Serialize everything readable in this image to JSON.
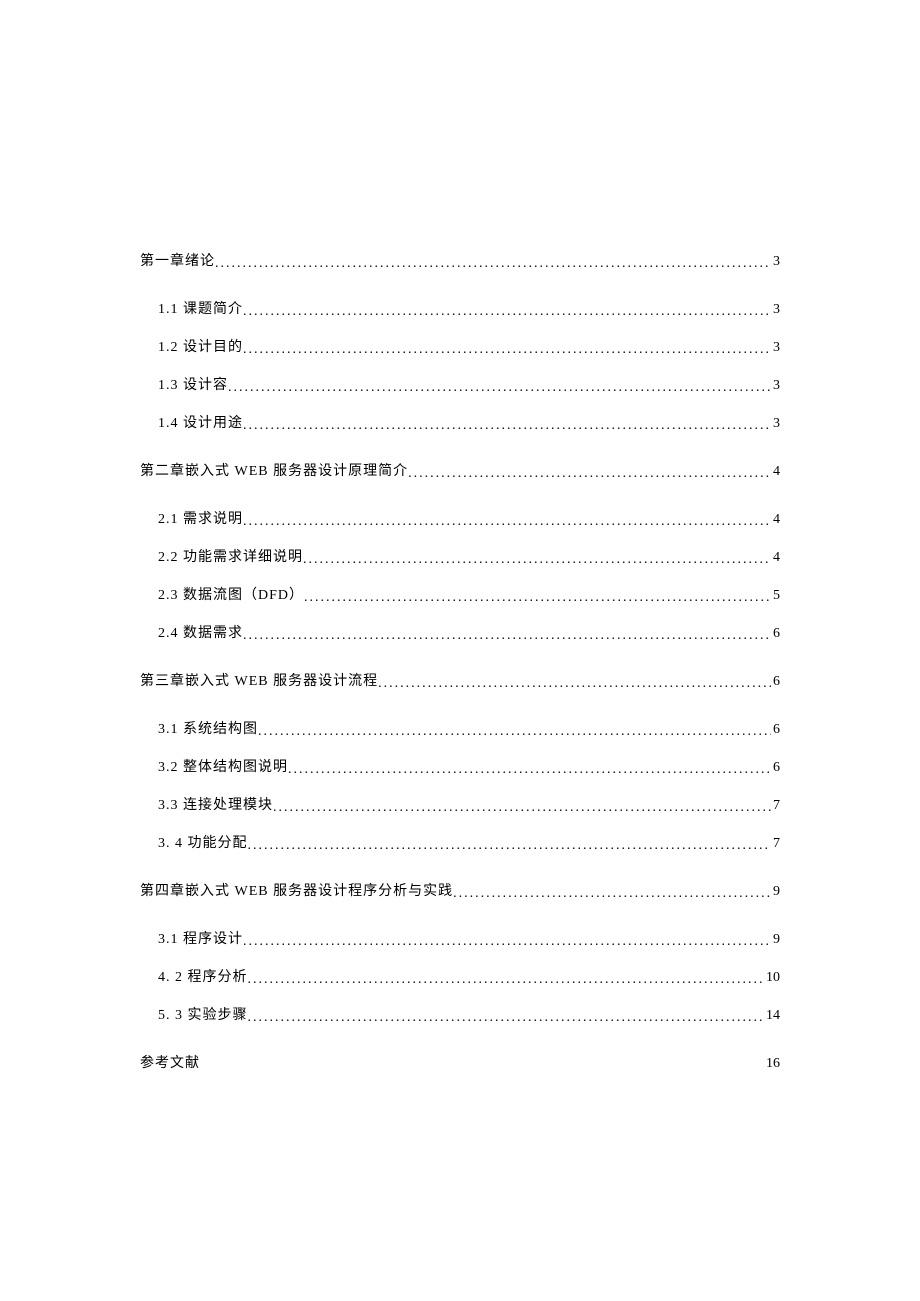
{
  "toc": [
    {
      "level": 1,
      "label": "第一章绪论",
      "page": "3",
      "leader": true
    },
    {
      "level": 2,
      "label": "1.1  课题简介",
      "page": "3",
      "leader": true,
      "first": true
    },
    {
      "level": 2,
      "label": "1.2  设计目的",
      "page": "3",
      "leader": true
    },
    {
      "level": 2,
      "label": "1.3  设计容",
      "page": "3",
      "leader": true
    },
    {
      "level": 2,
      "label": "1.4  设计用途",
      "page": "3",
      "leader": true
    },
    {
      "level": 1,
      "label": "第二章嵌入式 WEB 服务器设计原理简介",
      "page": "4",
      "leader": true,
      "spaced": true
    },
    {
      "level": 2,
      "label": "2.1  需求说明",
      "page": "4",
      "leader": true,
      "first": true
    },
    {
      "level": 2,
      "label": "2.2  功能需求详细说明",
      "page": "4",
      "leader": true
    },
    {
      "level": 2,
      "label": "2.3  数据流图（DFD）",
      "page": "5",
      "leader": true
    },
    {
      "level": 2,
      "label": "2.4  数据需求",
      "page": "6",
      "leader": true
    },
    {
      "level": 1,
      "label": "第三章嵌入式 WEB 服务器设计流程",
      "page": "6",
      "leader": true,
      "spaced": true
    },
    {
      "level": 2,
      "label": "3.1  系统结构图",
      "page": "6",
      "leader": true,
      "first": true
    },
    {
      "level": 2,
      "label": "3.2  整体结构图说明",
      "page": "6",
      "leader": true
    },
    {
      "level": 2,
      "label": "3.3  连接处理模块",
      "page": "7",
      "leader": true
    },
    {
      "level": 2,
      "label": "3.  4 功能分配",
      "page": "7",
      "leader": true
    },
    {
      "level": 1,
      "label": "第四章嵌入式 WEB 服务器设计程序分析与实践",
      "page": "9",
      "leader": true,
      "spaced": true
    },
    {
      "level": 2,
      "label": "3.1  程序设计",
      "page": "9",
      "leader": true,
      "first": true
    },
    {
      "level": 2,
      "label": "4.  2 程序分析",
      "page": "10",
      "leader": true
    },
    {
      "level": 2,
      "label": "5.  3 实验步骤",
      "page": "14",
      "leader": true
    },
    {
      "level": 1,
      "label": "参考文献",
      "page": "16",
      "leader": false,
      "spaced": true
    }
  ]
}
